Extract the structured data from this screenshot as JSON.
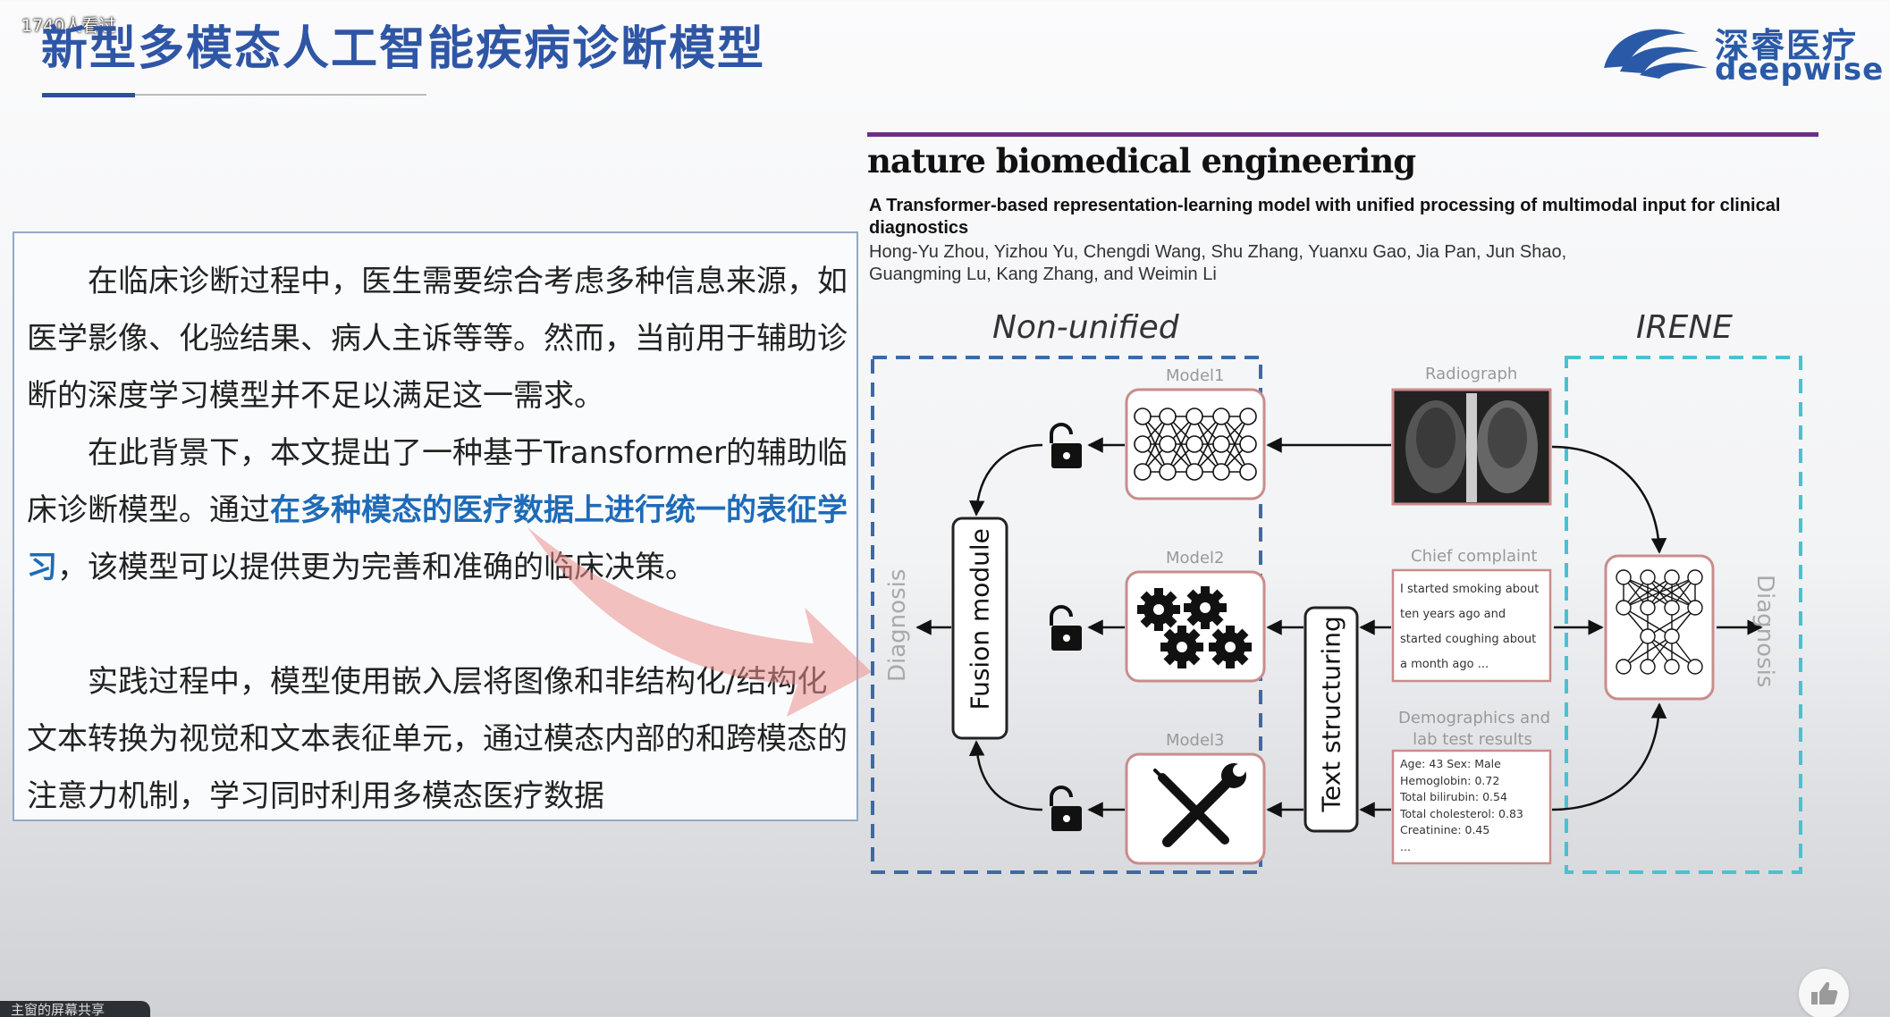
{
  "stream": {
    "viewer_count": "1740人看过",
    "share_tab_label": "主窗的屏幕共享"
  },
  "slide": {
    "title": "新型多模态人工智能疾病诊断模型",
    "logo": {
      "cn": "深睿医疗",
      "en": "deepwise",
      "icon": "wave-logo-icon"
    },
    "paragraphs": {
      "p1": "在临床诊断过程中，医生需要综合考虑多种信息来源，如医学影像、化验结果、病人主诉等等。然而，当前用于辅助诊断的深度学习模型并不足以满足这一需求。",
      "p2_before": "在此背景下，本文提出了一种基于Transformer的辅助临床诊断模型。通过",
      "p2_highlight": "在多种模态的医疗数据上进行统一的表征学习",
      "p2_after": "，该模型可以提供更为完善和准确的临床决策。",
      "p3": "实践过程中，模型使用嵌入层将图像和非结构化/结构化文本转换为视觉和文本表征单元，通过模态内部的和跨模态的注意力机制，学习同时利用多模态医疗数据"
    }
  },
  "paper": {
    "journal": "nature biomedical engineering",
    "title": "A Transformer-based representation-learning model with unified processing of multimodal input for clinical diagnostics",
    "authors_line1": "Hong-Yu Zhou, Yizhou Yu, Chengdi Wang, Shu Zhang, Yuanxu Gao, Jia Pan, Jun Shao,",
    "authors_line2": "Guangming Lu, Kang Zhang, and Weimin Li"
  },
  "diagram": {
    "non_unified_heading": "Non-unified",
    "irene_heading": "IRENE",
    "diagnosis_left": "Diagnosis",
    "diagnosis_right": "Diagnosis",
    "fusion_module": "Fusion module",
    "text_structuring": "Text structuring",
    "model1": "Model1",
    "model2": "Model2",
    "model3": "Model3",
    "radiograph": "Radiograph",
    "chief_complaint": "Chief complaint",
    "chief_complaint_lines": [
      "I started smoking about",
      "ten years ago and",
      "started coughing about",
      "a month ago ..."
    ],
    "demographics_title_l1": "Demographics and",
    "demographics_title_l2": "lab test results",
    "lab_lines": [
      "Age: 43 Sex: Male",
      "Hemoglobin: 0.72",
      "Total bilirubin: 0.54",
      "Total cholesterol: 0.83",
      "Creatinine: 0.45",
      "..."
    ],
    "colors": {
      "left_dash": "#3d6aa6",
      "right_dash": "#49c2cf",
      "box_border": "#c98c8c",
      "rule": "#6b2f86"
    }
  }
}
